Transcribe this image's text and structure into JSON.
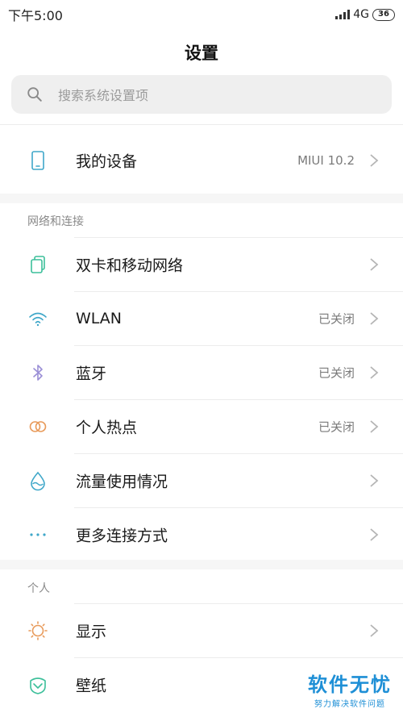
{
  "status_bar": {
    "time": "下午5:00",
    "network": "4G",
    "battery": "36"
  },
  "page": {
    "title": "设置"
  },
  "search": {
    "placeholder": "搜索系统设置项"
  },
  "device": {
    "label": "我的设备",
    "value": "MIUI 10.2"
  },
  "sections": {
    "network": {
      "header": "网络和连接",
      "items": [
        {
          "label": "双卡和移动网络",
          "value": ""
        },
        {
          "label": "WLAN",
          "value": "已关闭"
        },
        {
          "label": "蓝牙",
          "value": "已关闭"
        },
        {
          "label": "个人热点",
          "value": "已关闭"
        },
        {
          "label": "流量使用情况",
          "value": ""
        },
        {
          "label": "更多连接方式",
          "value": ""
        }
      ]
    },
    "personal": {
      "header": "个人",
      "items": [
        {
          "label": "显示",
          "value": ""
        },
        {
          "label": "壁纸",
          "value": ""
        }
      ]
    }
  },
  "watermark": {
    "main": "软件无忧",
    "sub": "努力解决软件问题"
  },
  "icons": {
    "device": "phone-icon",
    "sim": "sim-card-icon",
    "wlan": "wifi-icon",
    "bluetooth": "bluetooth-icon",
    "hotspot": "hotspot-icon",
    "data": "data-usage-icon",
    "more": "more-dots-icon",
    "display": "brightness-icon",
    "wallpaper": "wallpaper-icon"
  },
  "colors": {
    "device": "#3fa7c9",
    "sim": "#3cbf9a",
    "wlan": "#3fa7c9",
    "bluetooth": "#9b8fd6",
    "hotspot": "#e89a5a",
    "data": "#3fa7c9",
    "more": "#3fa7c9",
    "display": "#e89a5a",
    "wallpaper": "#3cbf9a"
  }
}
